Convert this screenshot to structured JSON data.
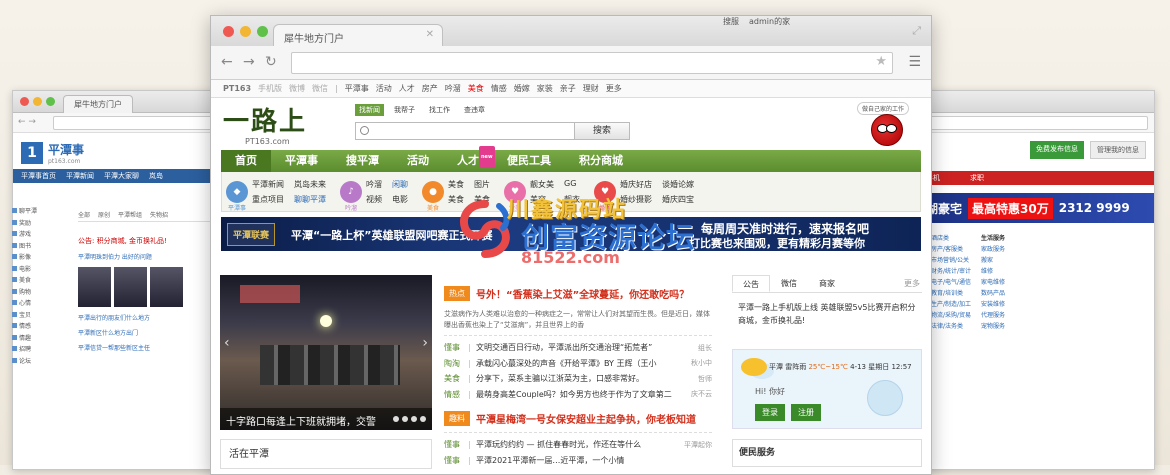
{
  "back_left": {
    "tab_title": "犀牛地方门户",
    "logo_num": "1",
    "logo_name": "平潭事",
    "logo_sub": "pt163.com",
    "nav": [
      "平潭事首页",
      "平潭新闻",
      "平潭大家聊",
      "岚岛"
    ],
    "side_items": [
      "聊平潭",
      "奖励",
      "游戏",
      "图书",
      "影像",
      "电影",
      "美食",
      "购物",
      "心情",
      "宝贝",
      "情感",
      "情趣",
      "招聘",
      "论坛"
    ],
    "tabs": [
      "全部",
      "原创",
      "平潭帮组",
      "失物招"
    ],
    "announce": "公告: 积分商城, 金币换礼品!",
    "lines": [
      "平潭明珠到伯力 出好的问题",
      "平潭出行的朋友们什么地方",
      "平潭新区什么地方出门",
      "平潭信贷一帮那些新区主任"
    ]
  },
  "back_right": {
    "btn_green": "免费发布信息",
    "btn_grey": "管理我的信息",
    "nav": [
      "手机",
      "求职"
    ],
    "banner_text": "湖豪宅",
    "banner_red": "最高特惠30万",
    "banner_phone": "2312 9999",
    "col1": [
      "酒店类",
      "房产/客服类",
      "市场营销/公关",
      "财务/统计/审计",
      "电子/电气/通信",
      "教育/培训类",
      "生产/制造/加工",
      "物流/采购/贸易",
      "法律/法务类"
    ],
    "col2_title": "生活服务",
    "col2": [
      "家政服务",
      "搬家",
      "维修",
      "家电维修",
      "数码产品",
      "安装维修",
      "代理服务",
      "宠物服务",
      "婚庆服务"
    ]
  },
  "front": {
    "tab_title": "犀牛地方门户",
    "topbar": {
      "site": "PT163",
      "grey_links": [
        "手机版",
        "微博",
        "微信"
      ],
      "links": [
        "平潭事",
        "活动",
        "人才",
        "房产",
        "吟溜",
        "美食",
        "情感",
        "婚嫁",
        "家装",
        "亲子",
        "理财",
        "更多"
      ],
      "hot_index": 5,
      "right": [
        "搜服",
        "admin的家"
      ]
    },
    "logo_big": "一路上",
    "logo_small": "PT163.com",
    "search_tabs": [
      "找新闻",
      "我帮子",
      "找工作",
      "查违章"
    ],
    "search_button": "搜索",
    "spider_bubble": "做自己家的工作",
    "nav": [
      "首页",
      "平潭事",
      "搜平潭",
      "活动",
      "人才",
      "便民工具",
      "积分商城"
    ],
    "nav_new": "new",
    "sub_groups": [
      {
        "icon": "平潭事",
        "color": "#5a96d3",
        "links": [
          "平潭新闻",
          "岚岛未来",
          "重点项目",
          "聊聊平潭"
        ]
      },
      {
        "icon": "吟溜",
        "color": "#b879c9",
        "links": [
          "吟溜",
          "闲聊",
          "视频",
          "电影"
        ]
      },
      {
        "icon": "美食",
        "color": "#f28a2b",
        "links": [
          "美食",
          "图片",
          "美食",
          "美食"
        ]
      },
      {
        "icon": "爱美",
        "color": "#e96fa8",
        "links": [
          "靓女美",
          "GG",
          "美容",
          "靓衣"
        ]
      },
      {
        "icon": "婚嫁",
        "color": "#e94a4a",
        "links": [
          "婚庆好店",
          "谈婚论嫁",
          "婚纱摄影",
          "婚庆四宝"
        ]
      }
    ],
    "banner": {
      "logo": "平潭联赛",
      "title": "平潭“一路上杯”英雄联盟网吧赛正式开赛",
      "right1": "每周周天准时进行，速来报名吧",
      "right2": "打比赛也来围观，更有精彩月赛等你"
    },
    "photo_caption": "十字路口每逢上下班就拥堵，交警",
    "life_title": "活在平潭",
    "headline1": {
      "tag": "热点",
      "title": "号外！“香蕉染上艾滋”全球蔓延，你还敢吃吗？"
    },
    "summary": "艾滋病作为人类难以治愈的一种病症之一，常常让人们对其望而生畏。但是近日，媒体曝出香蕉也染上了“艾滋病”，并且世界上的香",
    "news": [
      {
        "cat": "懂事",
        "txt": "文明交通百日行动，平潭派出所交通治理“拓荒者”",
        "au": "组长"
      },
      {
        "cat": "陶淘",
        "txt": "承载闪心蕞深处的声音《开给平潭》BY 王辉（王小",
        "au": "秋小中"
      },
      {
        "cat": "美食",
        "txt": "分享下，菜系主骗以江浙菜为主，口感非常好。",
        "au": "哲师"
      },
      {
        "cat": "情感",
        "txt": "最萌身高差Couple吗？如今男方也终于作为了文章第二。",
        "au": "庆不云"
      }
    ],
    "headline2": {
      "tag": "趣料",
      "title": "平潭星梅湾一号女保安超业主起争执，你老板知道"
    },
    "news2": [
      {
        "cat": "懂事",
        "txt": "平潭玩约约约 — 抓住春春时光，作还在等什么",
        "au": "平潭起你"
      },
      {
        "cat": "懂事",
        "txt": "平潭2021平潭新一届…近平潭，一个小情",
        "au": ""
      }
    ],
    "right_tabs": [
      "公告",
      "微信",
      "商家"
    ],
    "right_more": "更多",
    "right_text": "平潭一路上手机版上线  英雄联盟5v5比赛开启积分商城，金币换礼品!",
    "weather": {
      "city": "平潭",
      "cond": "雷阵雨",
      "temp": "25℃~15℃",
      "date": "4-13 星期日 12:57"
    },
    "greeting": "Hi! 你好",
    "login_btn": "登录",
    "reg_btn": "注册",
    "service": "便民服务"
  },
  "watermark": {
    "t1": "川鑫源码站",
    "t2": "创富资源论坛",
    "t3": "81522.com"
  }
}
